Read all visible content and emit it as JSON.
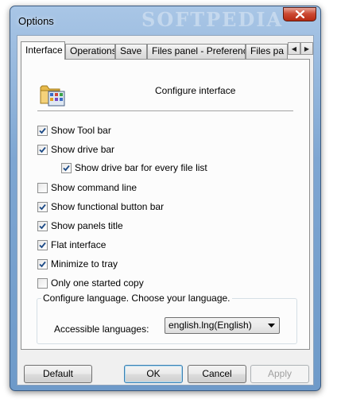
{
  "window": {
    "title": "Options"
  },
  "tabs": [
    {
      "label": "Interface",
      "active": true
    },
    {
      "label": "Operations",
      "active": false
    },
    {
      "label": "Save",
      "active": false
    },
    {
      "label": "Files panel - Preference",
      "active": false
    },
    {
      "label": "Files pa",
      "active": false
    }
  ],
  "header": {
    "text": "Configure interface",
    "icon": "folder-settings-icon"
  },
  "options": [
    {
      "label": "Show Tool bar",
      "checked": true
    },
    {
      "label": "Show drive bar",
      "checked": true
    },
    {
      "label": "Show drive bar for every file list",
      "checked": true
    },
    {
      "label": "Show command line",
      "checked": false
    },
    {
      "label": "Show functional button bar",
      "checked": true
    },
    {
      "label": "Show panels title",
      "checked": true
    },
    {
      "label": "Flat interface",
      "checked": true
    },
    {
      "label": "Minimize to tray",
      "checked": true
    },
    {
      "label": "Only one started copy",
      "checked": false
    }
  ],
  "language": {
    "group_label": "Configure language. Choose your language.",
    "field_label": "Accessible languages:",
    "selected": "english.lng(English)"
  },
  "buttons": {
    "default": "Default",
    "ok": "OK",
    "cancel": "Cancel",
    "apply": "Apply"
  },
  "colors": {
    "accent": "#3c7fb1",
    "check": "#1c4a86"
  }
}
